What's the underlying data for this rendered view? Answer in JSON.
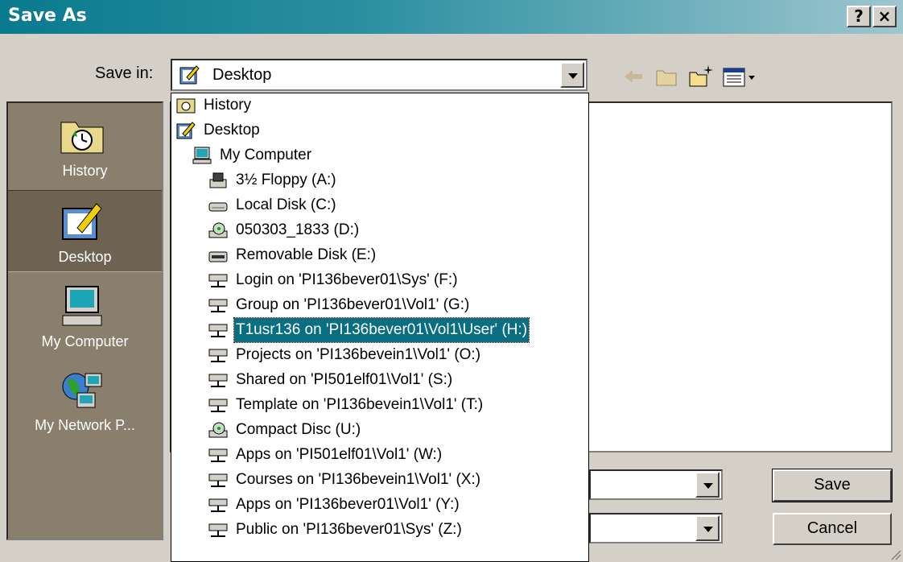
{
  "window": {
    "title": "Save As",
    "help_label": "?",
    "close_label": "×"
  },
  "save_in": {
    "label": "Save in:",
    "value": "Desktop"
  },
  "places": [
    {
      "label": "History"
    },
    {
      "label": "Desktop"
    },
    {
      "label": "My Computer"
    },
    {
      "label": "My Network P..."
    }
  ],
  "dropdown": {
    "items": [
      {
        "label": "History",
        "icon": "history-icon"
      },
      {
        "label": "Desktop",
        "icon": "desktop-icon"
      },
      {
        "label": "My Computer",
        "icon": "computer-icon"
      },
      {
        "label": "3½ Floppy (A:)",
        "icon": "floppy-icon"
      },
      {
        "label": "Local Disk (C:)",
        "icon": "disk-icon"
      },
      {
        "label": "050303_1833 (D:)",
        "icon": "cd-icon"
      },
      {
        "label": "Removable Disk (E:)",
        "icon": "removable-disk-icon"
      },
      {
        "label": "Login on 'PI136bever01\\Sys' (F:)",
        "icon": "network-drive-icon"
      },
      {
        "label": "Group on 'PI136bever01\\Vol1' (G:)",
        "icon": "network-drive-icon"
      },
      {
        "label": "T1usr136 on 'PI136bever01\\Vol1\\User' (H:)",
        "icon": "network-drive-icon"
      },
      {
        "label": "Projects on 'PI136bevein1\\Vol1' (O:)",
        "icon": "network-drive-icon"
      },
      {
        "label": "Shared on 'PI501elf01\\Vol1' (S:)",
        "icon": "network-drive-icon"
      },
      {
        "label": "Template on 'PI136bevein1\\Vol1' (T:)",
        "icon": "network-drive-icon"
      },
      {
        "label": "Compact Disc (U:)",
        "icon": "cd-icon"
      },
      {
        "label": "Apps on 'PI501elf01\\Vol1' (W:)",
        "icon": "network-drive-icon"
      },
      {
        "label": "Courses on 'PI136bevein1\\Vol1' (X:)",
        "icon": "network-drive-icon"
      },
      {
        "label": "Apps on 'PI136bever01\\Vol1' (Y:)",
        "icon": "network-drive-icon"
      },
      {
        "label": "Public on 'PI136bever01\\Sys' (Z:)",
        "icon": "network-drive-icon"
      }
    ],
    "highlighted_label": "T1usr136 on 'PI136bever01\\Vol1\\User' (H:)"
  },
  "buttons": {
    "save": "Save",
    "cancel": "Cancel"
  },
  "colors": {
    "title_start": "#0a7a8e",
    "highlight": "#0a6e82",
    "places_bg": "#8a7f6c"
  }
}
